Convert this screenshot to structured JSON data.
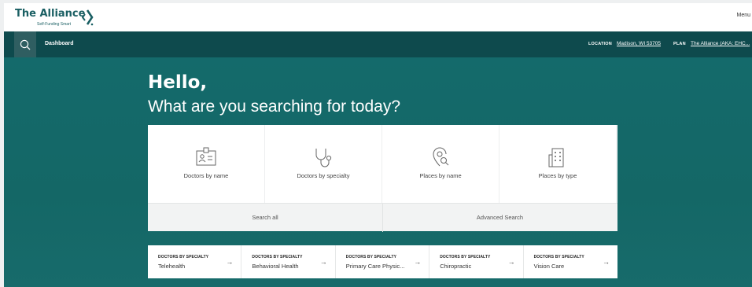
{
  "header": {
    "logo_text": "The Alliance",
    "logo_tagline": "Self-Funding Smart",
    "menu_label": "Menu"
  },
  "nav": {
    "dashboard_label": "Dashboard",
    "location_label": "LOCATION",
    "location_value": "Madison, WI 53705",
    "plan_label": "PLAN",
    "plan_value": "The Alliance (AKA: EHC..."
  },
  "hero": {
    "greeting": "Hello,",
    "prompt": "What are you searching for today?"
  },
  "search_categories": [
    {
      "label": "Doctors by name",
      "icon": "id-card-icon"
    },
    {
      "label": "Doctors by specialty",
      "icon": "stethoscope-icon"
    },
    {
      "label": "Places by name",
      "icon": "map-pin-search-icon"
    },
    {
      "label": "Places by type",
      "icon": "building-icon"
    }
  ],
  "search_actions": {
    "search_all": "Search all",
    "advanced_search": "Advanced Search"
  },
  "quick_links": [
    {
      "kicker": "DOCTORS BY SPECIALTY",
      "label": "Telehealth"
    },
    {
      "kicker": "DOCTORS BY SPECIALTY",
      "label": "Behavioral Health"
    },
    {
      "kicker": "DOCTORS BY SPECIALTY",
      "label": "Primary Care Physic..."
    },
    {
      "kicker": "DOCTORS BY SPECIALTY",
      "label": "Chiropractic"
    },
    {
      "kicker": "DOCTORS BY SPECIALTY",
      "label": "Vision Care"
    }
  ],
  "colors": {
    "brand_teal": "#1a5f63",
    "nav_dark": "#0e4a4d",
    "hero_bg": "#146a6b"
  }
}
